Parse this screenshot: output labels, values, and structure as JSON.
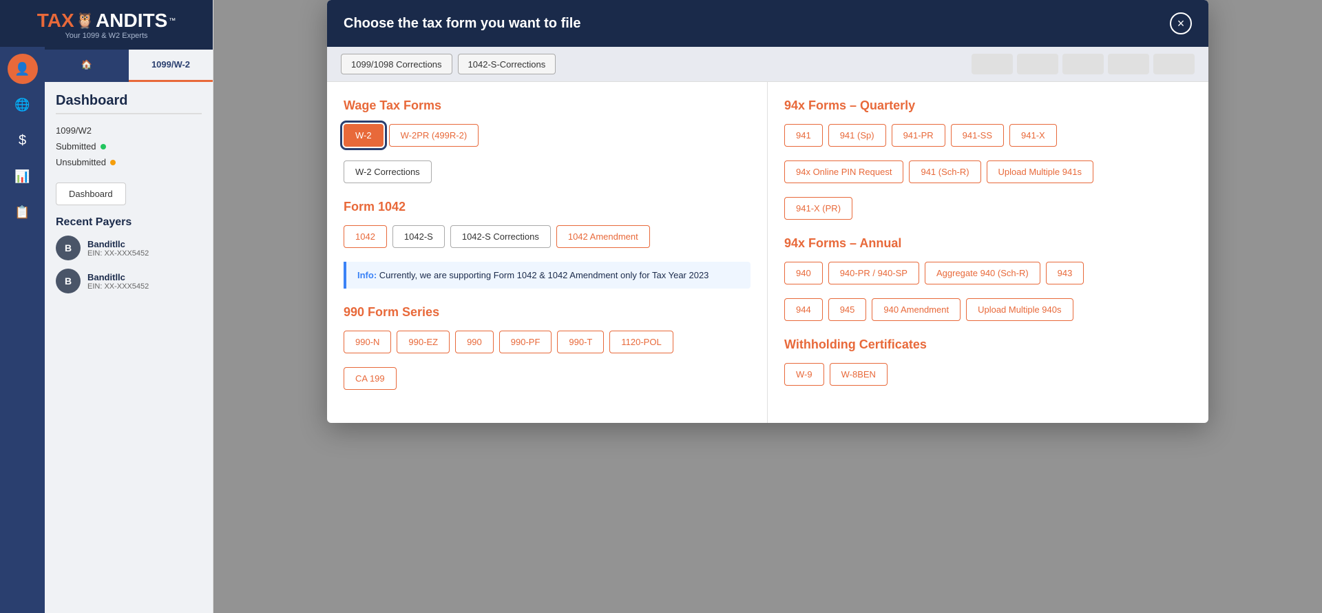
{
  "sidebar": {
    "logo_main": "TAX",
    "logo_brand": "ANDITS",
    "logo_tm": "™",
    "logo_sub": "Your 1099 & W2 Experts",
    "icons": [
      {
        "name": "user-icon",
        "symbol": "👤",
        "active": true
      },
      {
        "name": "globe-icon",
        "symbol": "🌐",
        "active": false
      },
      {
        "name": "dollar-icon",
        "symbol": "💲",
        "active": false
      },
      {
        "name": "chart-icon",
        "symbol": "📊",
        "active": false
      },
      {
        "name": "doc-icon",
        "symbol": "📋",
        "active": false
      }
    ],
    "tabs": [
      {
        "label": "🏠",
        "text": "",
        "id": "home",
        "active": false
      },
      {
        "label": "1099/W-2",
        "id": "forms",
        "active": true
      }
    ],
    "dashboard_title": "Dashboard",
    "nav_items": [
      {
        "label": "1099/W2",
        "id": "1099w2"
      },
      {
        "label": "Submitted",
        "id": "submitted",
        "dot": "green"
      },
      {
        "label": "Unsubmitted",
        "id": "unsubmitted",
        "dot": "yellow"
      }
    ],
    "dashboard_btn": "Dashboard",
    "recent_payers_title": "Recent Payers",
    "payers": [
      {
        "initial": "B",
        "name": "Banditllc",
        "ein": "EIN: XX-XXX5452"
      },
      {
        "initial": "B",
        "name": "Banditllc",
        "ein": "EIN: XX-XXX5452"
      }
    ]
  },
  "modal": {
    "title": "Choose the tax form you want to file",
    "close_label": "×",
    "top_bar_buttons": [
      "1099/1098 Corrections",
      "1042-S-Corrections"
    ],
    "sections": {
      "left": [
        {
          "heading": "Wage Tax Forms",
          "buttons": [
            {
              "label": "W-2",
              "selected": true
            },
            {
              "label": "W-2PR (499R-2)",
              "selected": false
            }
          ],
          "extra_buttons": [
            {
              "label": "W-2 Corrections",
              "gray": true
            }
          ]
        },
        {
          "heading": "Form 1042",
          "buttons": [
            {
              "label": "1042",
              "selected": false,
              "orange": true
            },
            {
              "label": "1042-S",
              "selected": false,
              "orange": false,
              "gray": true
            },
            {
              "label": "1042-S Corrections",
              "selected": false,
              "gray": true
            },
            {
              "label": "1042 Amendment",
              "selected": false,
              "orange": true
            }
          ],
          "info": {
            "label": "Info:",
            "text": " Currently, we are supporting Form 1042 & 1042 Amendment only for Tax Year 2023"
          }
        },
        {
          "heading": "990 Form Series",
          "buttons": [
            {
              "label": "990-N",
              "orange": true
            },
            {
              "label": "990-EZ",
              "orange": true
            },
            {
              "label": "990",
              "orange": true
            },
            {
              "label": "990-PF",
              "orange": true
            },
            {
              "label": "990-T",
              "orange": true
            },
            {
              "label": "1120-POL",
              "orange": true
            }
          ],
          "extra_buttons": [
            {
              "label": "CA 199",
              "orange": true
            }
          ]
        }
      ],
      "right": [
        {
          "heading": "94x Forms – Quarterly",
          "buttons": [
            {
              "label": "941"
            },
            {
              "label": "941 (Sp)"
            },
            {
              "label": "941-PR"
            },
            {
              "label": "941-SS"
            },
            {
              "label": "941-X"
            }
          ],
          "extra_rows": [
            [
              {
                "label": "94x Online PIN Request"
              },
              {
                "label": "941 (Sch-R)"
              },
              {
                "label": "Upload Multiple 941s"
              }
            ],
            [
              {
                "label": "941-X (PR)"
              }
            ]
          ]
        },
        {
          "heading": "94x Forms – Annual",
          "buttons": [
            {
              "label": "940"
            },
            {
              "label": "940-PR / 940-SP"
            },
            {
              "label": "Aggregate 940 (Sch-R)"
            },
            {
              "label": "943"
            }
          ],
          "extra_rows": [
            [
              {
                "label": "944"
              },
              {
                "label": "945"
              },
              {
                "label": "940 Amendment"
              },
              {
                "label": "Upload Multiple 940s"
              }
            ]
          ]
        },
        {
          "heading": "Withholding Certificates",
          "buttons": [
            {
              "label": "W-9"
            },
            {
              "label": "W-8BEN"
            }
          ]
        }
      ]
    }
  }
}
